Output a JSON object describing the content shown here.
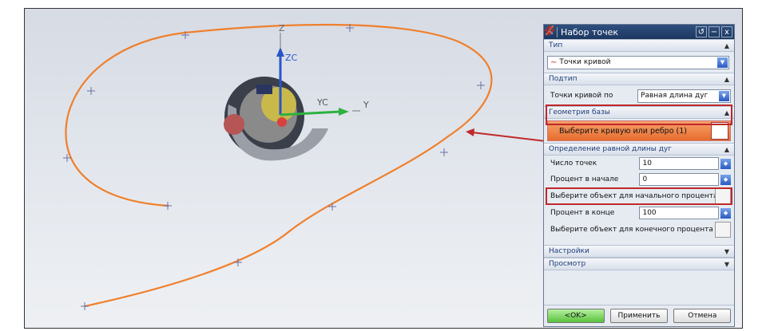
{
  "viewport": {
    "axes": {
      "z": "Z",
      "zc": "ZC",
      "yc": "YC",
      "y": "Y"
    }
  },
  "dialog": {
    "title": "Набор точек",
    "title_buttons": [
      "↺",
      "−",
      "x"
    ],
    "sections": {
      "type": {
        "label": "Тип"
      },
      "subtype": {
        "label": "Подтип"
      },
      "base": {
        "label": "Геометрия базы"
      },
      "arc": {
        "label": "Определение равной длины дуг"
      },
      "settings": {
        "label": "Настройки"
      },
      "preview": {
        "label": "Просмотр"
      }
    },
    "type_value": "Точки кривой",
    "subtype_label": "Точки кривой по",
    "subtype_value": "Равная длина дуг",
    "select_curve": "Выберите кривую или ребро (1)",
    "points_label": "Число точек",
    "points_value": "10",
    "start_label": "Процент в начале",
    "start_value": "0",
    "start_obj_label": "Выберите объект для начального процента",
    "end_label": "Процент в конце",
    "end_value": "100",
    "end_obj_label": "Выберите объект для конечного процента",
    "ok": "<OK>",
    "apply": "Применить",
    "cancel": "Отмена"
  },
  "colors": {
    "curve": "#f07f2b",
    "highlight": "#c0282a",
    "accent": "#1d3760"
  }
}
